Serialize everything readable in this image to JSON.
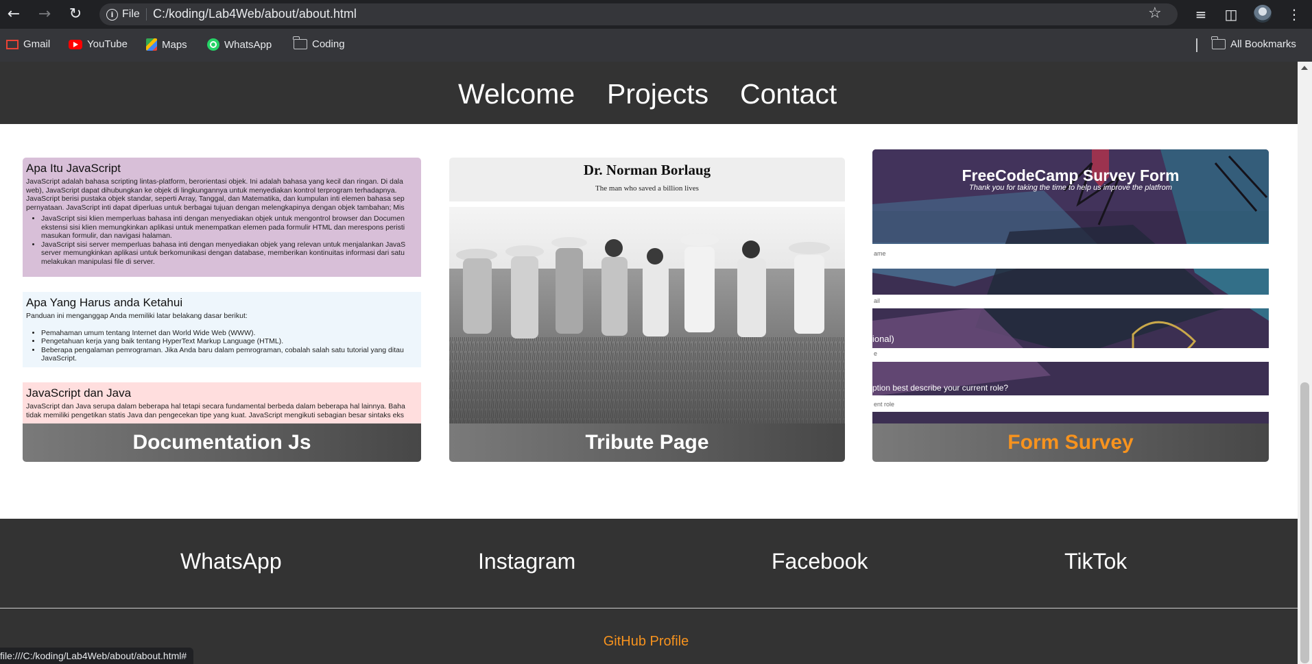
{
  "browser": {
    "chip_label": "File",
    "url": "C:/koding/Lab4Web/about/about.html",
    "status_url": "file:///C:/koding/Lab4Web/about/about.html#",
    "bookmarks": [
      {
        "label": "Gmail",
        "icon": "gmail-icon"
      },
      {
        "label": "YouTube",
        "icon": "youtube-icon"
      },
      {
        "label": "Maps",
        "icon": "maps-icon"
      },
      {
        "label": "WhatsApp",
        "icon": "whatsapp-icon"
      },
      {
        "label": "Coding",
        "icon": "folder-icon"
      }
    ],
    "all_bookmarks": "All Bookmarks"
  },
  "nav": {
    "links": [
      "Welcome",
      "Projects",
      "Contact"
    ]
  },
  "cards": [
    {
      "title": "Documentation Js",
      "sections": [
        {
          "heading": "Apa Itu JavaScript",
          "paragraphs": [
            "JavaScript adalah bahasa scripting lintas-platform, berorientasi objek. Ini adalah bahasa yang kecil dan ringan. Di dala",
            "web), JavaScript dapat dihubungkan ke objek di lingkungannya untuk menyediakan kontrol terprogram terhadapnya.",
            "JavaScript berisi pustaka objek standar, seperti Array, Tanggal, dan Matematika, dan kumpulan inti elemen bahasa sep",
            "pernyataan. JavaScript inti dapat diperluas untuk berbagai tujuan dengan melengkapinya dengan objek tambahan; Mis"
          ],
          "items": [
            [
              "JavaScript sisi klien memperluas bahasa inti dengan menyediakan objek untuk mengontrol browser dan Documen",
              "ekstensi sisi klien memungkinkan aplikasi untuk menempatkan elemen pada formulir HTML dan merespons peristi",
              "masukan formulir, dan navigasi halaman."
            ],
            [
              "JavaScript sisi server memperluas bahasa inti dengan menyediakan objek yang relevan untuk menjalankan JavaS",
              "server memungkinkan aplikasi untuk berkomunikasi dengan database, memberikan kontinuitas informasi dari satu",
              "melakukan manipulasi file di server."
            ]
          ]
        },
        {
          "heading": "Apa Yang Harus anda Ketahui",
          "paragraphs": [
            "Panduan ini menganggap Anda memiliki latar belakang dasar berikut:"
          ],
          "items": [
            [
              "Pemahaman umum tentang Internet dan World Wide Web (WWW)."
            ],
            [
              "Pengetahuan kerja yang baik tentang HyperText Markup Language (HTML)."
            ],
            [
              "Beberapa pengalaman pemrograman. Jika Anda baru dalam pemrograman, cobalah salah satu tutorial yang ditau",
              "JavaScript."
            ]
          ]
        },
        {
          "heading": "JavaScript dan Java",
          "paragraphs": [
            "JavaScript dan Java serupa dalam beberapa hal tetapi secara fundamental berbeda dalam beberapa hal lainnya. Baha",
            "tidak memiliki pengetikan statis Java dan pengecekan tipe yang kuat. JavaScript mengikuti sebagian besar sintaks eks"
          ],
          "items": []
        }
      ]
    },
    {
      "title": "Tribute Page",
      "heading": "Dr. Norman Borlaug",
      "subheading": "The man who saved a billion lives"
    },
    {
      "title": "Form Survey",
      "heading": "FreeCodeCamp Survey Form",
      "subheading": "Thank you for taking the time to help us improve the platfrom",
      "fragments": [
        "ame",
        "ail",
        "ional)",
        "e",
        "ption best describe your current role?",
        "ent role"
      ]
    }
  ],
  "footer": {
    "links": [
      "WhatsApp",
      "Instagram",
      "Facebook",
      "TikTok"
    ],
    "github": "GitHub Profile"
  },
  "colors": {
    "accent": "#f7931e",
    "nav_bg": "#333333",
    "doc_sec1": "#d8bfd8",
    "doc_sec2": "#eef6fc",
    "doc_sec3": "#ffdede"
  }
}
